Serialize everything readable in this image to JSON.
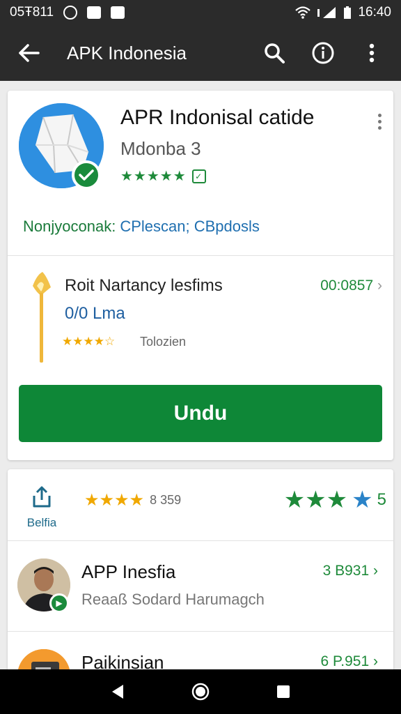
{
  "status_bar": {
    "carrier": "05Ŧ811",
    "time": "16:40"
  },
  "app_bar": {
    "title": "APK Indonesia",
    "icons": [
      "back-arrow-icon",
      "search-icon",
      "info-icon",
      "overflow-menu-icon"
    ]
  },
  "featured": {
    "title": "APR Indonisal catide",
    "subtitle": "Mdonba 3",
    "rating_stars": "★★★★★",
    "tags": {
      "primary": "Nonjyoconak:",
      "secondary": "CPlescan; CBpdosls"
    },
    "item": {
      "name": "Roit Nartancy lesfims",
      "subtitle": "0/0 Lma",
      "stars": "★★★★☆",
      "meta": "Tolozien",
      "price": "00:0857"
    },
    "install_label": "Undu"
  },
  "reviews": {
    "share_label": "Belfia",
    "left_stars": "★★★★",
    "left_count": "8 359",
    "right_stars_green": "★★★",
    "right_stars_blue": "★",
    "right_value": "5"
  },
  "list": [
    {
      "title": "APP Inesfia",
      "subtitle": "Reaaß Sodard Harumagch",
      "price": "3 B931"
    },
    {
      "title": "Paikinsian",
      "subtitle": "",
      "price": "6 P.951"
    }
  ],
  "colors": {
    "bar": "#2b2b2b",
    "accent_green": "#0e8737",
    "link_blue": "#1f6fb0",
    "star_gold": "#f0a800"
  }
}
